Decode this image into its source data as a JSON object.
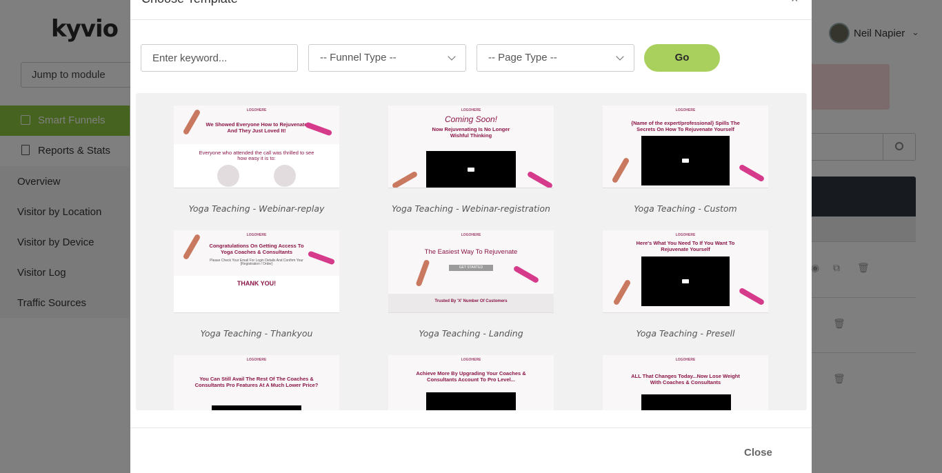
{
  "app": {
    "logo": "kyvio",
    "jump_to_module": "Jump to module",
    "sidebar": {
      "active": "Smart Funnels",
      "reports": "Reports & Stats",
      "sub_items": [
        "Overview",
        "Visitor by Location",
        "Visitor by Device",
        "Visitor Log",
        "Traffic Sources"
      ]
    },
    "user": {
      "name": "Neil Napier"
    }
  },
  "modal": {
    "title": "Choose Template",
    "search": {
      "placeholder": "Enter keyword..."
    },
    "funnel_type": {
      "value": "-- Funnel Type --"
    },
    "page_type": {
      "value": "-- Page Type --"
    },
    "go_label": "Go",
    "close_label": "Close",
    "templates": [
      {
        "caption": "Yoga Teaching - Webinar-replay",
        "logo": "LOGOHERE",
        "headline": "We Showed Everyone How to Rejuvenate And They Just Loved It!",
        "body": "Everyone who attended the call was thrilled to see how easy it is to:"
      },
      {
        "caption": "Yoga Teaching - Webinar-registration",
        "logo": "LOGOHERE",
        "headline": "Coming Soon!",
        "sub": "Now Rejuvenating Is No Longer Wishful Thinking"
      },
      {
        "caption": "Yoga Teaching - Custom",
        "logo": "LOGOHERE",
        "headline": "{Name of the expert/professional} Spills The Secrets On How To Rejuvenate Yourself"
      },
      {
        "caption": "Yoga Teaching - Thankyou",
        "logo": "LOGOHERE",
        "headline": "Congratulations On Getting Access To Yoga Coaches & Consultants",
        "sub": "Please Check Your Email For Login Details And Confirm Your {Registration / Order}",
        "thanks": "THANK YOU!"
      },
      {
        "caption": "Yoga Teaching - Landing",
        "logo": "LOGOHERE",
        "headline": "The Easiest Way To Rejuvenate",
        "button": "GET STARTED",
        "trusted": "Trusted By 'X' Number Of Customers"
      },
      {
        "caption": "Yoga Teaching - Presell",
        "logo": "LOGOHERE",
        "headline": "Here's What You Need To If You Want To Rejuvenate Yourself"
      },
      {
        "caption": "",
        "logo": "LOGOHERE",
        "headline": "You Can Still Avail The Rest Of The Coaches & Consultants Pro Features At A Much Lower Price?"
      },
      {
        "caption": "",
        "logo": "LOGOHERE",
        "headline": "Achieve More By Upgrading Your Coaches & Consultants Account To Pro Level..."
      },
      {
        "caption": "",
        "logo": "LOGOHERE",
        "headline": "ALL That Changes Today...Now Lose Weight With Coaches & Consultants"
      }
    ]
  }
}
